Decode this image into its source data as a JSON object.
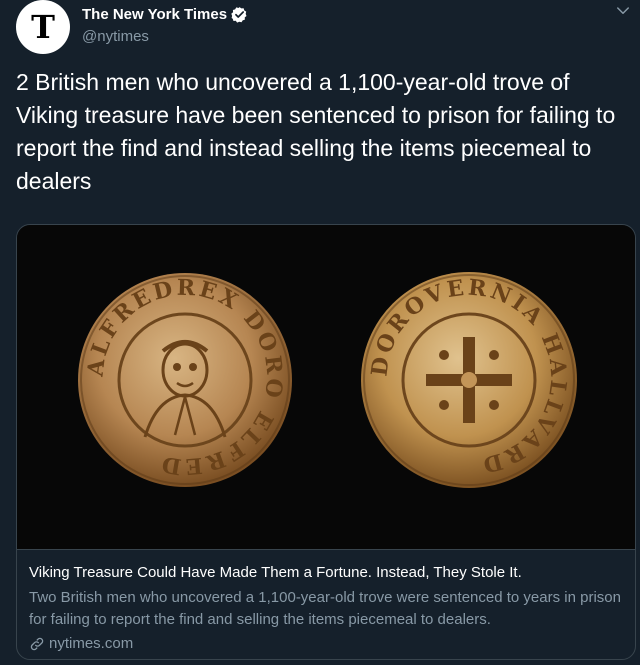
{
  "account": {
    "display_name": "The New York Times",
    "handle": "@nytimes",
    "avatar_letter": "T",
    "verified": true
  },
  "tweet": {
    "text": "2 British men who uncovered a 1,100-year-old trove of Viking treasure have been sentenced to prison for failing to report the find and instead selling the items piecemeal to dealers"
  },
  "card": {
    "image_subject": "two-gold-viking-coins",
    "left_coin_inscription": "ALFREDREX DORO ELFRED",
    "right_coin_inscription": "DOROVERNIA HALLVARD",
    "title": "Viking Treasure Could Have Made Them a Fortune. Instead, They Stole It.",
    "description": "Two British men who uncovered a 1,100-year-old trove were sentenced to years in prison for failing to report the find and selling the items piecemeal to dealers.",
    "domain": "nytimes.com"
  },
  "colors": {
    "background": "#15202b",
    "secondary_text": "#8899a6",
    "accent": "#1da1f2",
    "border": "#38444d"
  }
}
